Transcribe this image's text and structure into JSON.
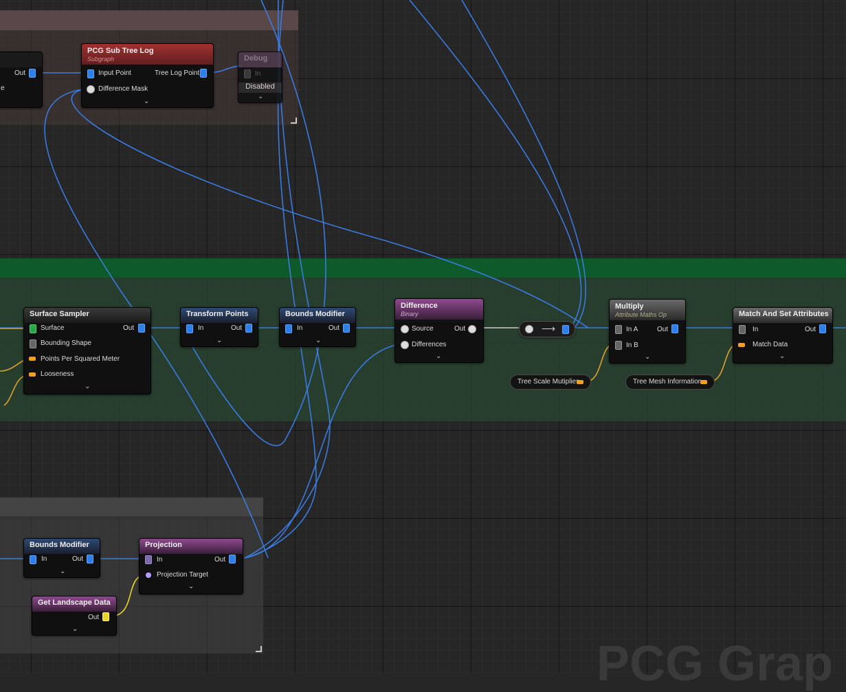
{
  "colors": {
    "wire_point": "#3a7be0",
    "wire_attr": "#e0a030",
    "header_subgraph": "#8e2a2a",
    "header_spatial": "#2a3a55",
    "header_binary": "#7a3a7a",
    "header_math": "#4a4a4a",
    "comment_green": "#0e5a2a"
  },
  "nodes": {
    "prev_out": {
      "out": "Out",
      "cut_label": "e"
    },
    "sub_tree_log": {
      "title": "PCG Sub Tree Log",
      "subtitle": "Subgraph",
      "input_point": "Input Point",
      "diff_mask": "Difference Mask",
      "tree_log_point": "Tree Log Point"
    },
    "debug": {
      "title": "Debug",
      "in": "In",
      "state": "Disabled"
    },
    "surface_sampler": {
      "title": "Surface Sampler",
      "surface": "Surface",
      "bounding_shape": "Bounding Shape",
      "ppsm": "Points Per Squared Meter",
      "looseness": "Looseness",
      "out": "Out"
    },
    "transform_points": {
      "title": "Transform Points",
      "in": "In",
      "out": "Out"
    },
    "bounds_modifier_top": {
      "title": "Bounds Modifier",
      "in": "In",
      "out": "Out"
    },
    "difference": {
      "title": "Difference",
      "subtitle": "Binary",
      "source": "Source",
      "differences": "Differences",
      "out": "Out"
    },
    "multiply": {
      "title": "Multiply",
      "subtitle": "Attribute Maths Op",
      "in_a": "In A",
      "in_b": "In B",
      "out": "Out"
    },
    "match_set": {
      "title": "Match And Set Attributes",
      "in": "In",
      "match_data": "Match Data",
      "out": "Out"
    },
    "tree_scale": {
      "label": "Tree Scale Mutiplier"
    },
    "tree_mesh": {
      "label": "Tree Mesh Information"
    },
    "bounds_modifier_bottom": {
      "title": "Bounds Modifier",
      "in": "In",
      "out": "Out"
    },
    "projection": {
      "title": "Projection",
      "in": "In",
      "target": "Projection Target",
      "out": "Out"
    },
    "landscape": {
      "title": "Get Landscape Data",
      "out": "Out"
    }
  },
  "icons": {
    "expand": "chevron-down-icon",
    "convert": "arrow-right-icon"
  },
  "watermark": "PCG Grap"
}
